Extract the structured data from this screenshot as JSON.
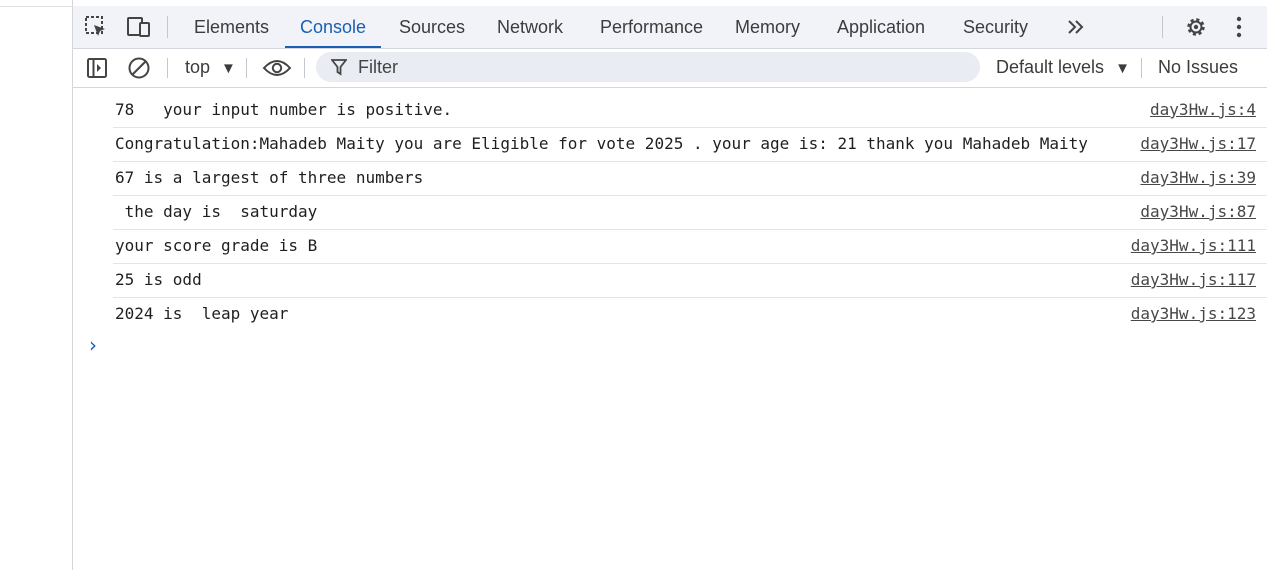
{
  "tabs": [
    {
      "label": "Elements",
      "active": false
    },
    {
      "label": "Console",
      "active": true
    },
    {
      "label": "Sources",
      "active": false
    },
    {
      "label": "Network",
      "active": false
    },
    {
      "label": "Performance",
      "active": false
    },
    {
      "label": "Memory",
      "active": false
    },
    {
      "label": "Application",
      "active": false
    },
    {
      "label": "Security",
      "active": false
    }
  ],
  "toolbar": {
    "context": "top",
    "filter_placeholder": "Filter",
    "levels": "Default levels",
    "issues": "No Issues"
  },
  "messages": [
    {
      "text": "78   your input number is positive.",
      "source": "day3Hw.js:4"
    },
    {
      "text": "Congratulation:Mahadeb Maity you are Eligible for vote 2025 . your age is: 21 thank you Mahadeb Maity",
      "source": "day3Hw.js:17"
    },
    {
      "text": "67 is a largest of three numbers",
      "source": "day3Hw.js:39"
    },
    {
      "text": " the day is  saturday",
      "source": "day3Hw.js:87"
    },
    {
      "text": "your score grade is B",
      "source": "day3Hw.js:111"
    },
    {
      "text": "25 is odd",
      "source": "day3Hw.js:117"
    },
    {
      "text": "2024 is  leap year",
      "source": "day3Hw.js:123"
    }
  ],
  "icons": {
    "inspect": "inspect-element-icon",
    "device": "device-toolbar-icon",
    "more_tabs": "more-tabs-chevron-icon",
    "settings": "gear-icon",
    "menu": "kebab-menu-icon",
    "sidebar": "sidebar-toggle-icon",
    "clear": "clear-console-icon",
    "eye": "live-expression-eye-icon",
    "filter": "filter-funnel-icon",
    "prompt": "console-prompt-chevron-icon"
  },
  "colors": {
    "accent": "#1a5fb4",
    "tabbar_bg": "#f1f3f9",
    "filter_bg": "#e9ecf3",
    "row_divider": "#e1e4ea"
  }
}
